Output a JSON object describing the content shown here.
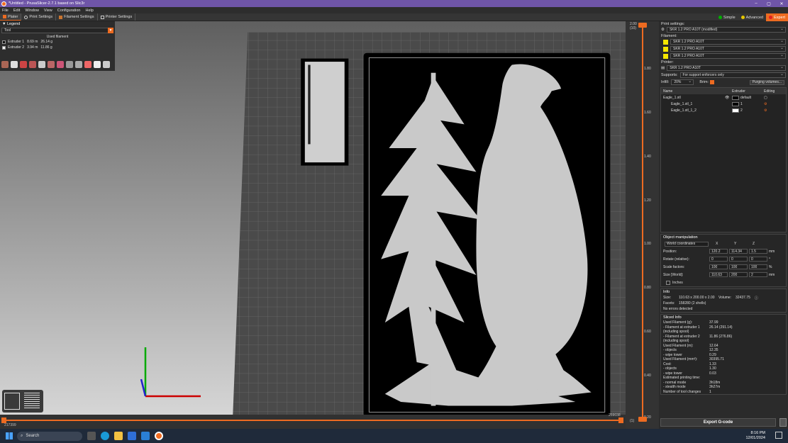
{
  "window": {
    "title": "*Untitled - PrusaSlicer-2.7.1 based on Slic3r"
  },
  "menu": [
    "File",
    "Edit",
    "Window",
    "View",
    "Configuration",
    "Help"
  ],
  "tabs": [
    "Plater",
    "Print Settings",
    "Filament Settings",
    "Printer Settings"
  ],
  "modes": {
    "simple": "Simple",
    "advanced": "Advanced",
    "expert": "Expert"
  },
  "legend": {
    "header": "Legend",
    "view_type": "Tool",
    "used_filament": "Used filament",
    "extruders": [
      {
        "name": "Extruder 1",
        "length": "8.69 m",
        "weight": "26.14 g",
        "color": "#111111"
      },
      {
        "name": "Extruder 2",
        "length": "3.94 m",
        "weight": "11.86 g",
        "color": "#f2f2f2"
      }
    ]
  },
  "ruler": {
    "top": "2.00",
    "top_layer": "(10)",
    "ticks": [
      "1.80",
      "1.60",
      "1.40",
      "1.20",
      "1.00",
      "0.80",
      "0.60",
      "0.40",
      "0.20"
    ],
    "bottom": "0.20",
    "bottom_layer": "(1)"
  },
  "hslider": {
    "left": "217399",
    "right": "259038"
  },
  "panel": {
    "print_settings_label": "Print settings:",
    "print_profile": "SKR 1.2 PRO A10T (modified)",
    "filament_label": "Filament:",
    "filaments": [
      "SKR 1.2 PRO A10T",
      "SKR 1.2 PRO A10T",
      "SKR 1.2 PRO A10T"
    ],
    "printer_label": "Printer:",
    "printer_profile": "SKR 1.2 PRO A10T",
    "supports_label": "Supports:",
    "supports_value": "For support enforcers only",
    "infill_label": "Infill:",
    "infill_value": "20%",
    "brim_label": "Brim:",
    "purging_button": "Purging volumes...",
    "list_headers": {
      "name": "Name",
      "extruder": "Extruder",
      "editing": "Editing"
    },
    "objects": [
      {
        "name": "Eagle_1.stl",
        "extruder": "default",
        "color": "#000000"
      },
      {
        "name": "Eagle_1.stl_1",
        "extruder": "1",
        "color": "#000000"
      },
      {
        "name": "Eagle_1.stl_1_2",
        "extruder": "2",
        "color": "#ffffff"
      }
    ]
  },
  "manip": {
    "header": "Object manipulation",
    "coords": "World coordinates",
    "axes": [
      "X",
      "Y",
      "Z"
    ],
    "position_label": "Position:",
    "position": [
      "120.2",
      "114.34",
      "1.5"
    ],
    "position_unit": "mm",
    "rotate_label": "Rotate (relative):",
    "rotate": [
      "0",
      "0",
      "0"
    ],
    "rotate_unit": "°",
    "scale_label": "Scale factors:",
    "scale": [
      "100",
      "100",
      "100"
    ],
    "scale_unit": "%",
    "size_label": "Size [World]:",
    "size": [
      "110.63",
      "200",
      "2"
    ],
    "size_unit": "mm",
    "inches": "Inches"
  },
  "info": {
    "header": "Info",
    "size_label": "Size:",
    "size": "110.63 x 200.00 x 2.00",
    "volume_label": "Volume:",
    "volume": "32437.75",
    "facets_label": "Facets:",
    "facets": "158280 (2 shells)",
    "errors": "No errors detected"
  },
  "sliced": {
    "header": "Sliced Info",
    "rows": [
      [
        "Used Filament (g):",
        "37.99"
      ],
      [
        "- Filament at extruder 1",
        "26.14 (291.14)"
      ],
      [
        "(including spool)",
        ""
      ],
      [
        "- Filament at extruder 2",
        "11.86 (276.86)"
      ],
      [
        "(including spool)",
        ""
      ],
      [
        "Used Filament (m):",
        "12.64"
      ],
      [
        "- objects",
        "12.35"
      ],
      [
        "- wipe tower",
        "0.29"
      ],
      [
        "Used Filament (mm³):",
        "30395.71"
      ],
      [
        "Cost:",
        "1.33"
      ],
      [
        "- objects",
        "1.30"
      ],
      [
        "- wipe tower",
        "0.03"
      ],
      [
        "Estimated printing time:",
        ""
      ],
      [
        "- normal mode",
        "3h18m"
      ],
      [
        "- stealth mode",
        "3h27m"
      ],
      [
        "Number of tool changes",
        "1"
      ]
    ]
  },
  "export_button": "Export G-code",
  "taskbar": {
    "search": "Search",
    "time": "8:16 PM",
    "date": "12/01/2024"
  }
}
